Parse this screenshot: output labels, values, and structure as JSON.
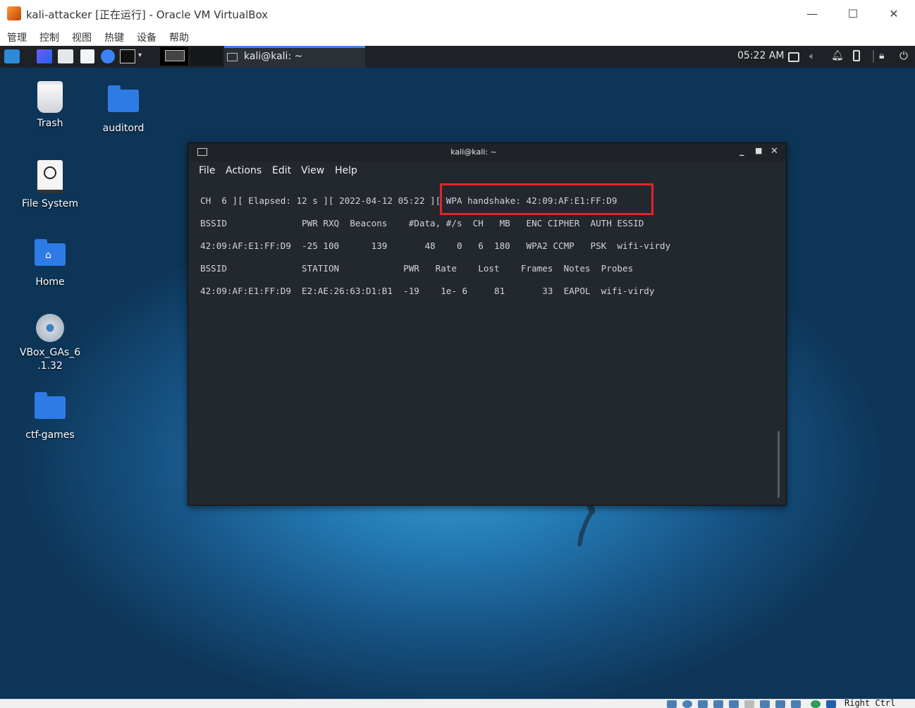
{
  "host_window": {
    "title": "kali-attacker [正在运行] - Oracle VM VirtualBox",
    "menu": [
      "管理",
      "控制",
      "视图",
      "热键",
      "设备",
      "帮助"
    ],
    "controls": {
      "minimize": "—",
      "maximize": "☐",
      "close": "✕"
    }
  },
  "panel": {
    "active_task": "kali@kali: ~",
    "clock": "05:22 AM"
  },
  "desktop_icons": [
    {
      "label": "Trash",
      "icon": "trash-icon"
    },
    {
      "label": "auditord",
      "icon": "folder-icon"
    },
    {
      "label": "File System",
      "icon": "drive-icon"
    },
    {
      "label": "Home",
      "icon": "home-folder-icon"
    },
    {
      "label": "VBox_GAs_6\n.1.32",
      "icon": "cd-icon"
    },
    {
      "label": "ctf-games",
      "icon": "folder-icon"
    }
  ],
  "terminal": {
    "title": "kali@kali: ~",
    "menu": [
      "File",
      "Actions",
      "Edit",
      "View",
      "Help"
    ],
    "lines": [
      "CH  6 ][ Elapsed: 12 s ][ 2022-04-12 05:22 ][ WPA handshake: 42:09:AF:E1:FF:D9",
      "BSSID              PWR RXQ  Beacons    #Data, #/s  CH   MB   ENC CIPHER  AUTH ESSID",
      "42:09:AF:E1:FF:D9  -25 100      139       48    0   6  180   WPA2 CCMP   PSK  wifi-virdy",
      "BSSID              STATION            PWR   Rate    Lost    Frames  Notes  Probes",
      "42:09:AF:E1:FF:D9  E2:AE:26:63:D1:B1  -19    1e- 6     81       33  EAPOL  wifi-virdy"
    ]
  },
  "statusbar": {
    "host_key": "Right Ctrl"
  },
  "colors": {
    "highlight_box": "#e0252b",
    "terminal_bg": "#23272e",
    "panel_bg": "#1e2125",
    "desktop_blue": "#2378b3"
  }
}
